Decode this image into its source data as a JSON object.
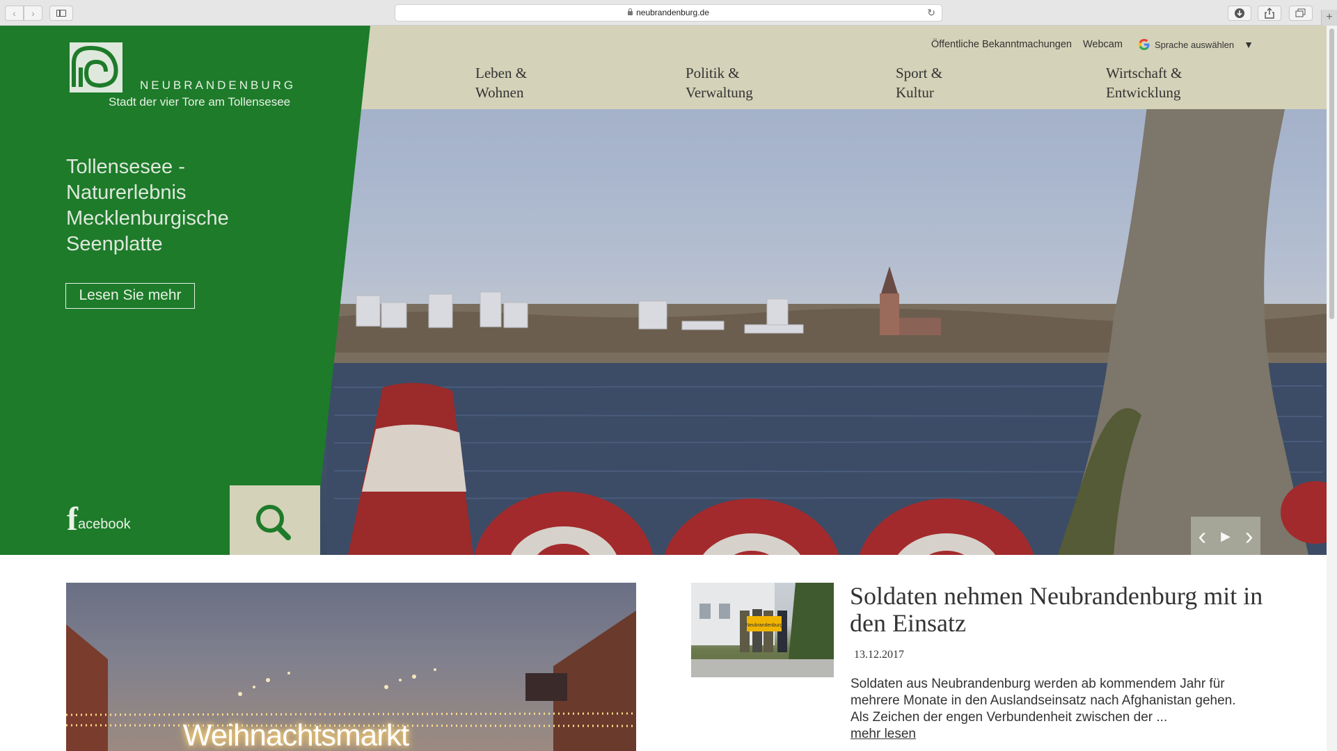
{
  "browser": {
    "url": "neubrandenburg.de"
  },
  "header": {
    "brand": "NEUBRANDENBURG",
    "tagline": "Stadt der vier Tore am Tollensesee",
    "util_links": [
      "Öffentliche Bekanntmachungen",
      "Webcam"
    ],
    "language_label": "Sprache auswählen",
    "nav": [
      {
        "line1": "Leben &",
        "line2": "Wohnen"
      },
      {
        "line1": "Politik &",
        "line2": "Verwaltung"
      },
      {
        "line1": "Sport &",
        "line2": "Kultur"
      },
      {
        "line1": "Wirtschaft &",
        "line2": "Entwicklung"
      }
    ]
  },
  "hero": {
    "title": "Tollensesee - Naturerlebnis Mecklenburgische Seenplatte",
    "button_label": "Lesen Sie mehr",
    "facebook_f": "f",
    "facebook_text": "acebook",
    "slider": {
      "prev": "‹",
      "play": "▶",
      "next": "›"
    }
  },
  "feature": {
    "sign_text": "Weihnachtsmarkt"
  },
  "news": {
    "title": "Soldaten nehmen Neubrandenburg mit in den Einsatz",
    "date": "13.12.2017",
    "text": "Soldaten aus Neubrandenburg werden ab kommendem Jahr für mehrere Monate in den Auslandseinsatz nach Afghanistan gehen. Als Zeichen der engen Verbundenheit zwischen der ...",
    "more": "mehr lesen",
    "thumb_sign": "Neubrandenburg"
  },
  "colors": {
    "brand_green": "#1d7b2a",
    "nav_beige": "#d4d2b8"
  },
  "icons": [
    "back-icon",
    "forward-icon",
    "sidebar-icon",
    "lock-icon",
    "reload-icon",
    "download-icon",
    "share-icon",
    "tabs-icon",
    "plus-icon",
    "google-icon",
    "search-icon",
    "facebook-icon"
  ]
}
